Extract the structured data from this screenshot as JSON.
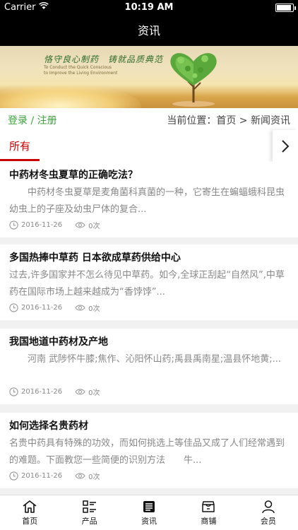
{
  "status_bar": {
    "carrier": "Carrier",
    "time": "10:19 AM"
  },
  "nav": {
    "title": "资讯"
  },
  "banner": {
    "slogan": "恪守良心制药　铸就品质典范",
    "sub_line1": "To Conduct the Quick Conscious",
    "sub_line2": "to Improve the Living Environment"
  },
  "crumbbar": {
    "login": "登录 / 注册",
    "location": "当前位置：首页 > 新闻资讯"
  },
  "tabs": {
    "active": "所有"
  },
  "articles": [
    {
      "title": "中药材冬虫夏草的正确吃法？",
      "summary": "　　中药材冬虫夏草是麦角菌科真菌的一种，它寄生在蝙蝠蛾科昆虫幼虫上的子座及幼虫尸体的复合...",
      "date": "2016-11-26",
      "views": "0次"
    },
    {
      "title": "多国热捧中草药 日本欲成草药供给中心",
      "summary": "过去,许多国家并不怎么待见中草药。如今,全球正刮起“自然风”,中草药在国际市场上越来越成为“香饽饽”...",
      "date": "2016-11-26",
      "views": "0次"
    },
    {
      "title": "我国地道中药材及产地",
      "summary": "　　河南 武陟怀牛膝;焦作、沁阳怀山药;禹县禹南星;温县怀地黄;...",
      "date": "2016-11-26",
      "views": "0次"
    },
    {
      "title": "如何选择名贵药材",
      "summary": "名贵中药具有特殊的功效，而如何挑选上等佳品又成了人们经常遇到的难题。下面教您一些简便的识别方法　　牛...",
      "date": "2016-11-26",
      "views": "0次"
    }
  ],
  "bottom_nav": [
    {
      "label": "首页",
      "icon": "home-icon"
    },
    {
      "label": "产品",
      "icon": "grid-list-icon"
    },
    {
      "label": "资讯",
      "icon": "news-icon"
    },
    {
      "label": "商铺",
      "icon": "shop-icon"
    },
    {
      "label": "会员",
      "icon": "user-icon"
    }
  ],
  "colors": {
    "accent_red": "#cc0000",
    "login_green": "#3aa33a",
    "bar_black": "#000000"
  }
}
